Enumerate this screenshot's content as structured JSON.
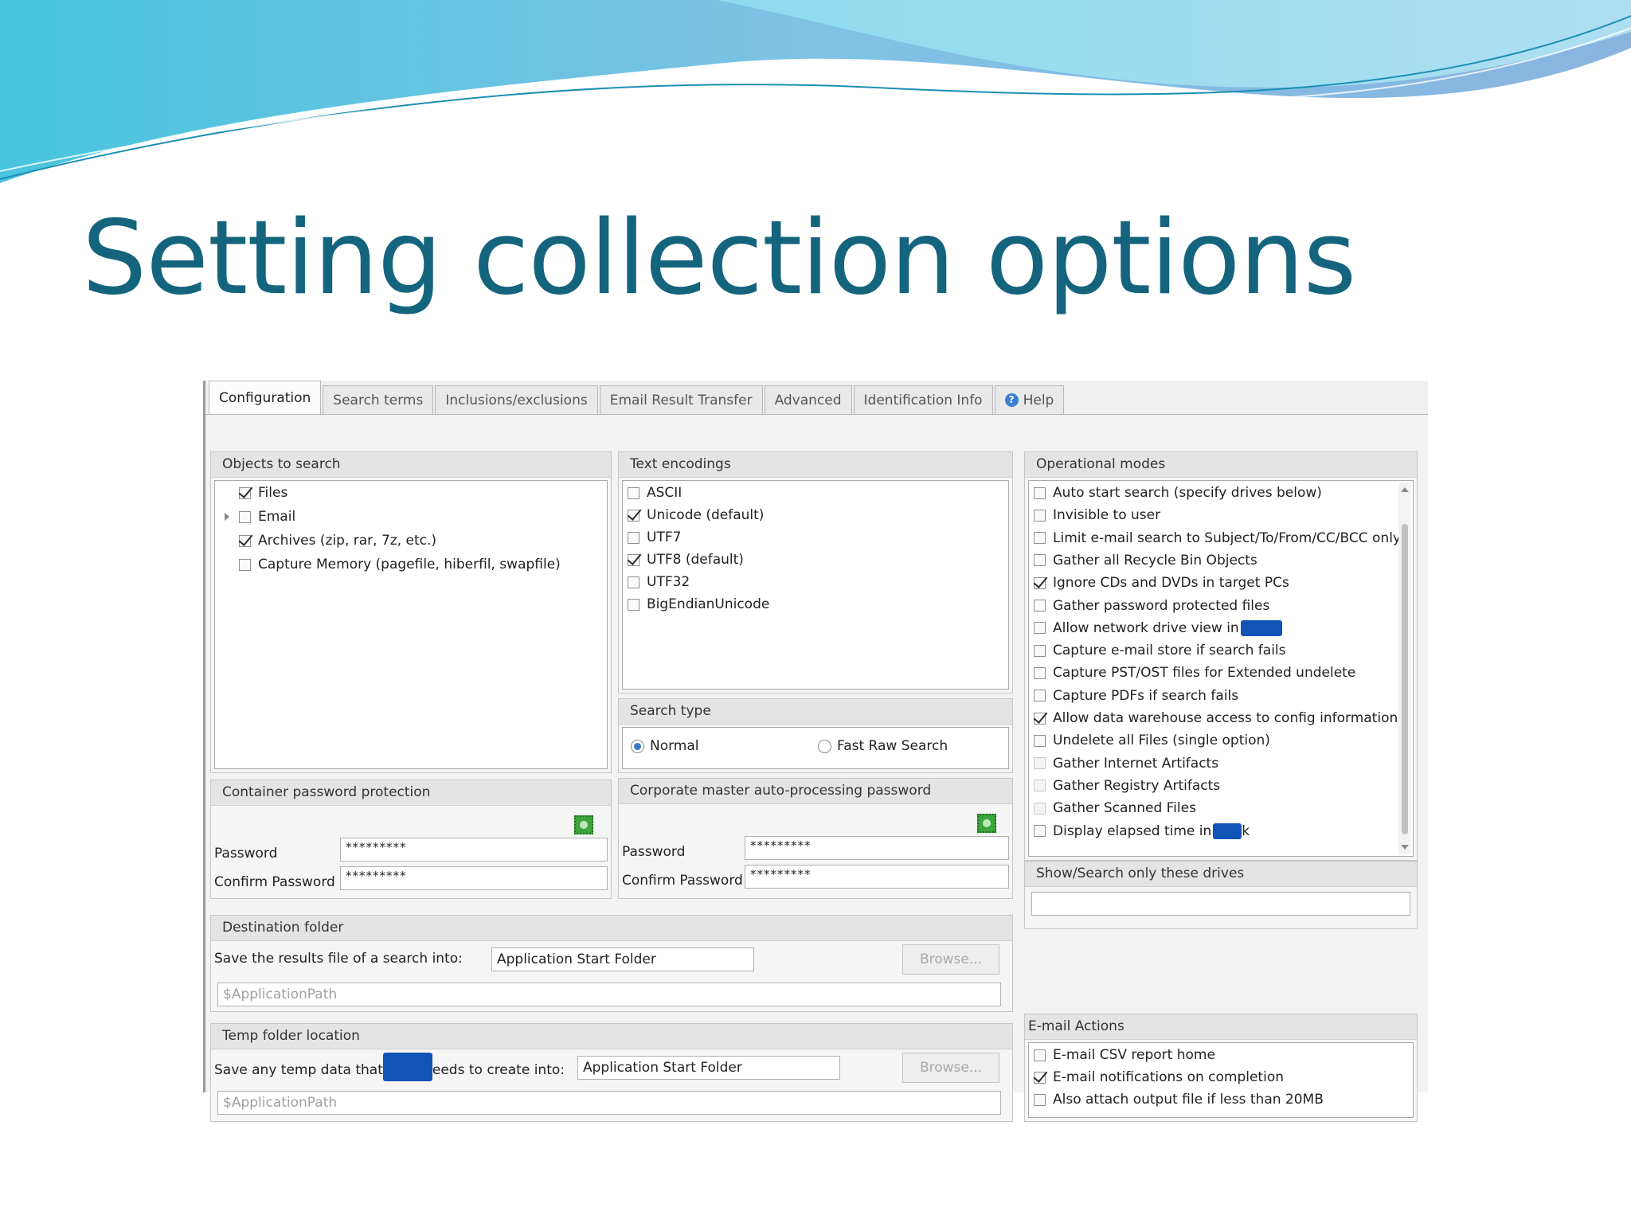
{
  "slide": {
    "title": "Setting collection options"
  },
  "tabs": [
    {
      "label": "Configuration",
      "active": true
    },
    {
      "label": "Search terms"
    },
    {
      "label": "Inclusions/exclusions"
    },
    {
      "label": "Email Result Transfer"
    },
    {
      "label": "Advanced"
    },
    {
      "label": "Identification Info"
    },
    {
      "label": "Help",
      "icon": "help-icon"
    }
  ],
  "objects_to_search": {
    "title": "Objects to search",
    "items": [
      {
        "label": "Files",
        "checked": true
      },
      {
        "label": "Email",
        "checked": false
      },
      {
        "label": "Archives (zip, rar, 7z, etc.)",
        "checked": true
      },
      {
        "label": "Capture Memory (pagefile, hiberfil, swapfile)",
        "checked": false
      }
    ]
  },
  "text_encodings": {
    "title": "Text encodings",
    "items": [
      {
        "label": "ASCII",
        "checked": false
      },
      {
        "label": "Unicode (default)",
        "checked": true
      },
      {
        "label": "UTF7",
        "checked": false
      },
      {
        "label": "UTF8 (default)",
        "checked": true
      },
      {
        "label": "UTF32",
        "checked": false
      },
      {
        "label": "BigEndianUnicode",
        "checked": false
      }
    ]
  },
  "search_type": {
    "title": "Search type",
    "normal": "Normal",
    "fast_raw": "Fast Raw Search",
    "selected": "Normal"
  },
  "operational_modes": {
    "title": "Operational modes",
    "items": [
      {
        "label": "Auto start search (specify drives below)",
        "checked": false
      },
      {
        "label": "Invisible to user",
        "checked": false
      },
      {
        "label": "Limit e-mail search to Subject/To/From/CC/BCC only",
        "checked": false
      },
      {
        "label": "Gather all Recycle Bin Objects",
        "checked": false
      },
      {
        "label": "Ignore CDs and DVDs in target PCs",
        "checked": true
      },
      {
        "label": "Gather password protected files",
        "checked": false
      },
      {
        "label": "Allow network drive view in",
        "checked": false,
        "redacted_suffix": true
      },
      {
        "label": "Capture e-mail store if search fails",
        "checked": false
      },
      {
        "label": "Capture PST/OST files for Extended undelete",
        "checked": false
      },
      {
        "label": "Capture PDFs if search fails",
        "checked": false
      },
      {
        "label": "Allow data warehouse access to config information",
        "checked": true
      },
      {
        "label": "Undelete all Files (single option)",
        "checked": false
      },
      {
        "label": "Gather Internet Artifacts",
        "checked": false,
        "disabled": true
      },
      {
        "label": "Gather Registry Artifacts",
        "checked": false,
        "disabled": true
      },
      {
        "label": "Gather Scanned Files",
        "checked": false,
        "disabled": true
      },
      {
        "label": "Display elapsed time in",
        "suffix": "k",
        "checked": false,
        "redacted_suffix": true
      }
    ]
  },
  "container_password": {
    "title": "Container password protection",
    "password_label": "Password",
    "confirm_label": "Confirm Password",
    "password_value": "*********",
    "confirm_value": "*********"
  },
  "corporate_password": {
    "title": "Corporate master auto-processing password",
    "password_label": "Password",
    "confirm_label": "Confirm Password",
    "password_value": "*********",
    "confirm_value": "*********"
  },
  "show_drives": {
    "title": "Show/Search only these drives",
    "value": ""
  },
  "destination_folder": {
    "title": "Destination folder",
    "label": "Save the results file of a search into:",
    "select_value": "Application Start Folder",
    "browse_label": "Browse...",
    "path": "$ApplicationPath"
  },
  "temp_folder": {
    "title": "Temp folder location",
    "label_start": "Save any temp data that",
    "label_end": "eeds to create into:",
    "select_value": "Application Start Folder",
    "browse_label": "Browse...",
    "path": "$ApplicationPath"
  },
  "email_actions": {
    "title": "E-mail Actions",
    "items": [
      {
        "label": "E-mail CSV report home",
        "checked": false
      },
      {
        "label": "E-mail notifications on completion",
        "checked": true
      },
      {
        "label": "Also attach output file if less than 20MB",
        "checked": false
      }
    ]
  },
  "colors": {
    "title": "#15647e",
    "wave_dark": "#1b8fb3",
    "wave_light": "#8fd8e8",
    "redaction": "#1254b5"
  }
}
